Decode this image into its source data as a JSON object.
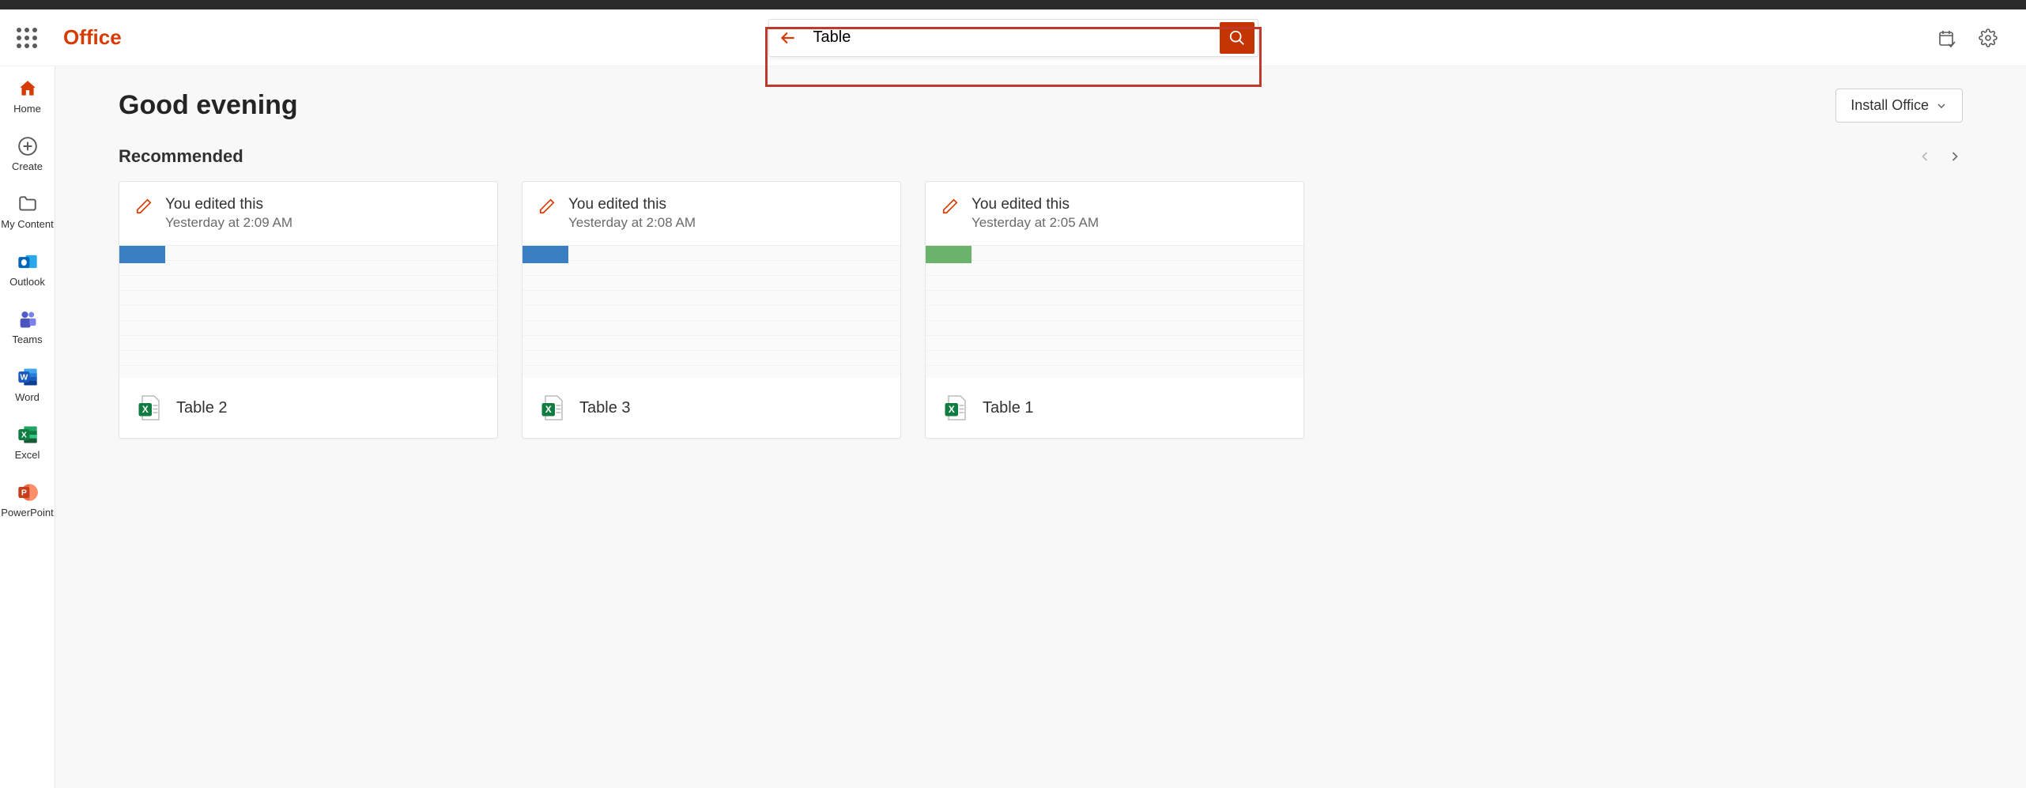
{
  "header": {
    "brand": "Office",
    "search_value": "Table"
  },
  "sidebar": {
    "items": [
      {
        "label": "Home"
      },
      {
        "label": "Create"
      },
      {
        "label": "My Content"
      },
      {
        "label": "Outlook"
      },
      {
        "label": "Teams"
      },
      {
        "label": "Word"
      },
      {
        "label": "Excel"
      },
      {
        "label": "PowerPoint"
      }
    ]
  },
  "main": {
    "greeting": "Good evening",
    "install_label": "Install Office",
    "recommended_title": "Recommended",
    "cards": [
      {
        "action": "You edited this",
        "time": "Yesterday at 2:09 AM",
        "name": "Table 2"
      },
      {
        "action": "You edited this",
        "time": "Yesterday at 2:08 AM",
        "name": "Table 3"
      },
      {
        "action": "You edited this",
        "time": "Yesterday at 2:05 AM",
        "name": "Table 1"
      }
    ]
  }
}
